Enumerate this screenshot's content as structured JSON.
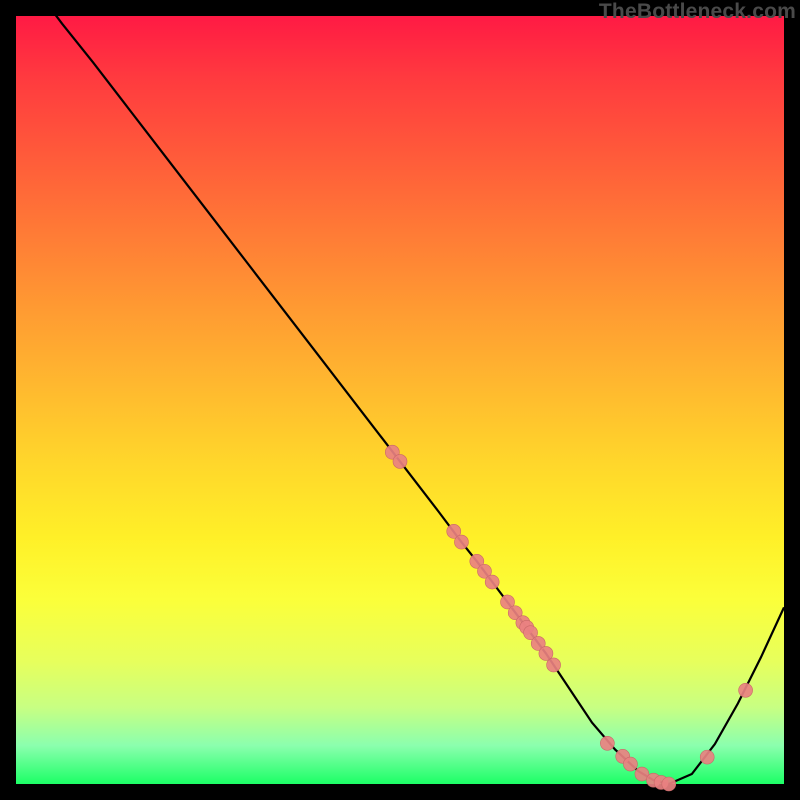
{
  "watermark": "TheBottleneck.com",
  "colors": {
    "curve_stroke": "#000000",
    "marker_fill": "#e98181",
    "marker_stroke": "#c96868",
    "background": "#000000"
  },
  "chart_data": {
    "type": "line",
    "title": "",
    "xlabel": "",
    "ylabel": "",
    "xlim": [
      0,
      100
    ],
    "ylim": [
      0,
      100
    ],
    "grid": false,
    "legend": false,
    "series": [
      {
        "name": "bottleneck-curve",
        "x": [
          0,
          3,
          6,
          10,
          15,
          20,
          25,
          30,
          35,
          40,
          45,
          50,
          55,
          58,
          60,
          63,
          66,
          69,
          72,
          75,
          78,
          81,
          83,
          85,
          88,
          91,
          94,
          97,
          100
        ],
        "values": [
          109,
          103,
          99,
          94,
          87.5,
          81,
          74.5,
          68,
          61.5,
          55,
          48.5,
          42,
          35.5,
          31.5,
          29,
          25,
          21,
          17,
          12.5,
          8,
          4.5,
          1.7,
          0.5,
          0,
          1.3,
          5.2,
          10.5,
          16.5,
          23
        ]
      }
    ],
    "markers": {
      "name": "highlighted-points",
      "x": [
        49,
        50,
        57,
        58,
        60,
        61,
        62,
        64,
        65,
        66,
        66.5,
        67,
        68,
        69,
        70,
        77,
        79,
        80,
        81.5,
        83,
        84,
        85,
        90,
        95
      ],
      "values": [
        43.2,
        42,
        32.9,
        31.5,
        29,
        27.7,
        26.3,
        23.7,
        22.3,
        21,
        20.4,
        19.7,
        18.3,
        17,
        15.5,
        5.3,
        3.6,
        2.6,
        1.3,
        0.5,
        0.2,
        0,
        3.5,
        12.2
      ]
    }
  }
}
